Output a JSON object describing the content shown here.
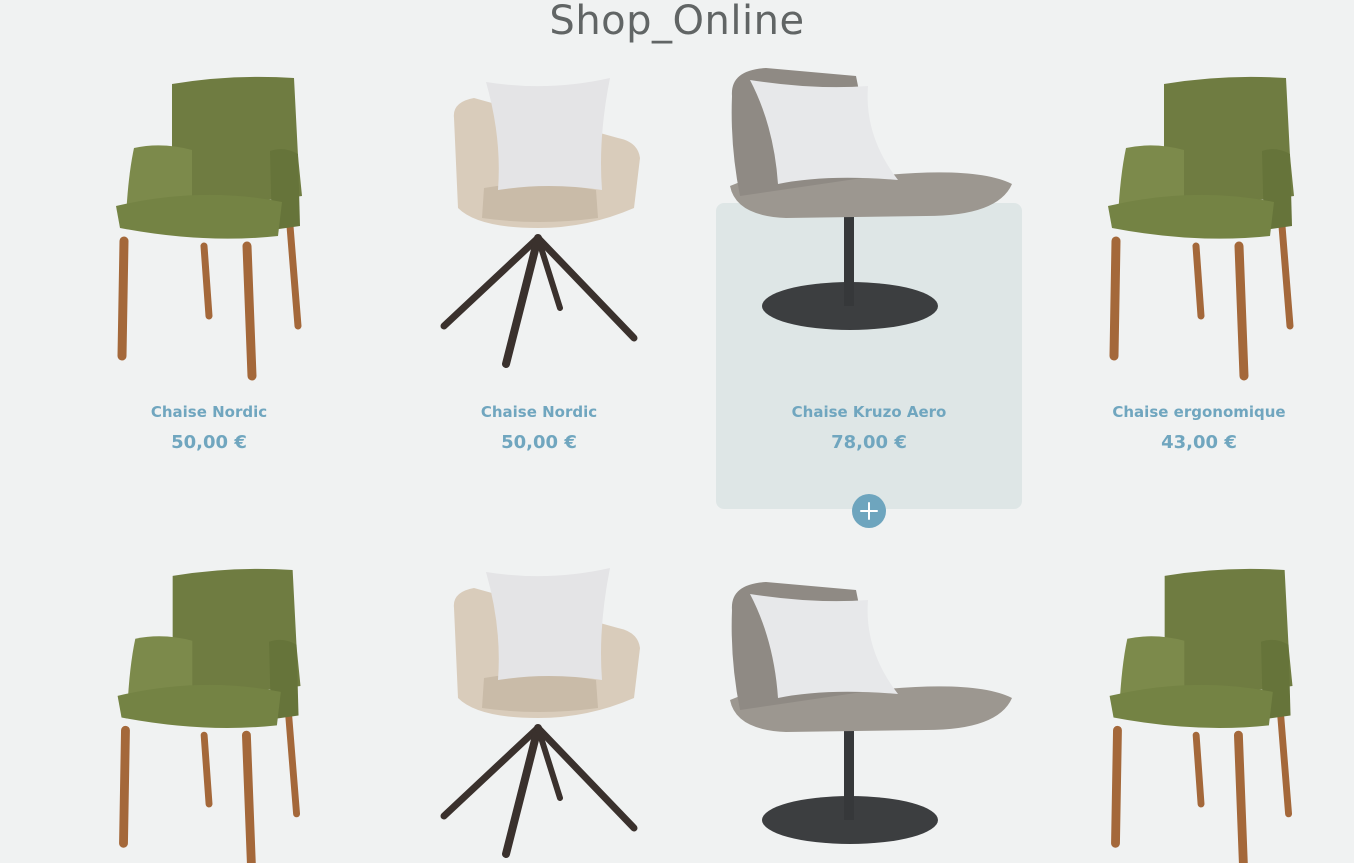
{
  "header": {
    "title": "Shop_Online"
  },
  "add_icon": "plus-icon",
  "colors": {
    "accent": "#70a6bf",
    "background": "#f0f2f2",
    "hover_card": "#dee6e6",
    "title": "#616565"
  },
  "products": [
    {
      "name": "Chaise Nordic",
      "price": "50,00 €",
      "image": "green-armchair"
    },
    {
      "name": "Chaise Nordic",
      "price": "50,00 €",
      "image": "beige-swivel-chair"
    },
    {
      "name": "Chaise Kruzo Aero",
      "price": "78,00 €",
      "image": "gray-lounge-chair"
    },
    {
      "name": "Chaise ergonomique",
      "price": "43,00 €",
      "image": "green-armchair"
    }
  ],
  "second_row": [
    {
      "image": "green-armchair"
    },
    {
      "image": "beige-swivel-chair"
    },
    {
      "image": "gray-lounge-chair"
    },
    {
      "image": "green-armchair"
    }
  ]
}
